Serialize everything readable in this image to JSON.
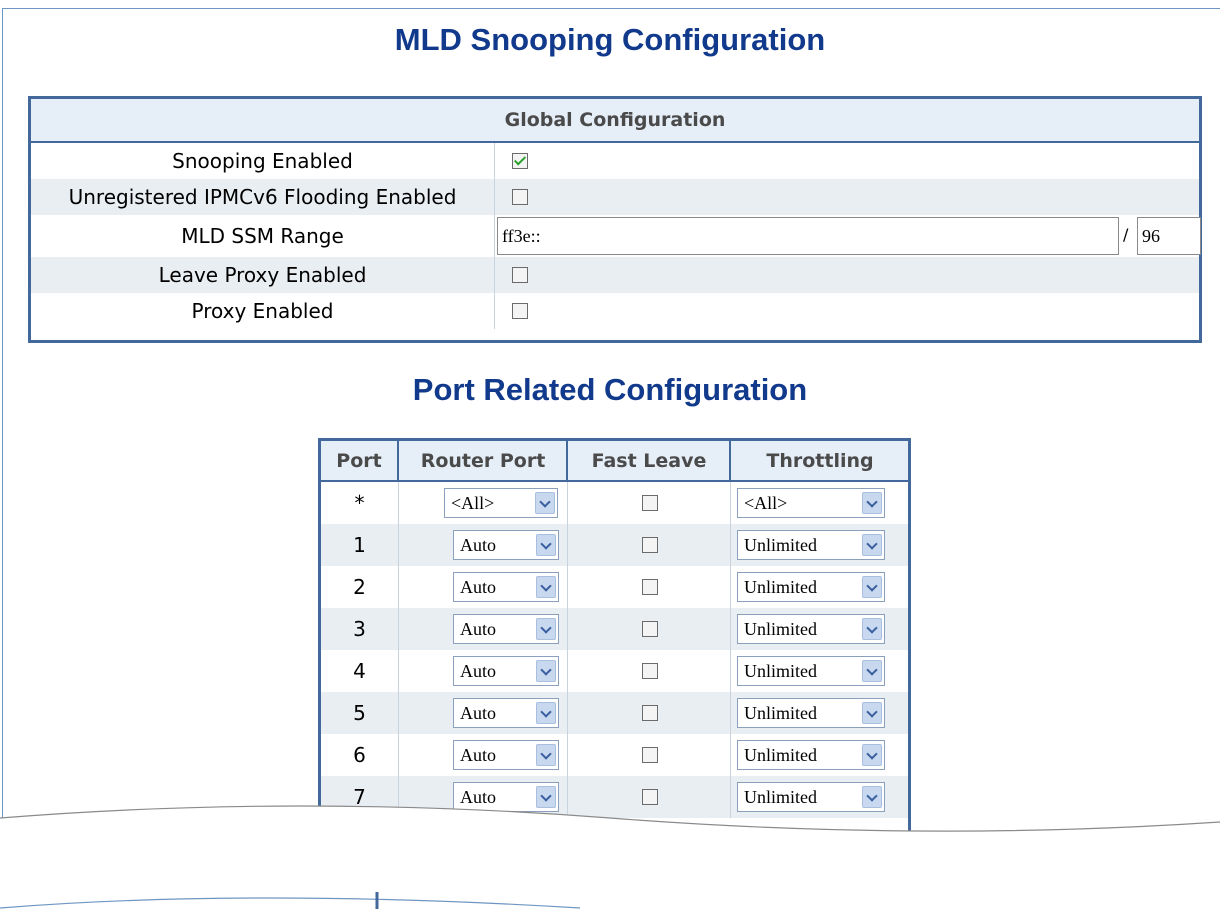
{
  "page_title": "MLD Snooping Configuration",
  "global": {
    "header": "Global Configuration",
    "rows": [
      {
        "label": "Snooping Enabled",
        "checked": true
      },
      {
        "label": "Unregistered IPMCv6 Flooding Enabled",
        "checked": false
      },
      {
        "label": "MLD SSM Range",
        "address": "ff3e::",
        "separator": "/",
        "prefix": "96"
      },
      {
        "label": "Leave Proxy Enabled",
        "checked": false
      },
      {
        "label": "Proxy Enabled",
        "checked": false
      }
    ]
  },
  "port_title": "Port Related Configuration",
  "port_table": {
    "headers": [
      "Port",
      "Router Port",
      "Fast Leave",
      "Throttling"
    ],
    "rows": [
      {
        "port": "*",
        "router": "<All>",
        "fast_leave": false,
        "throttling": "<All>"
      },
      {
        "port": "1",
        "router": "Auto",
        "fast_leave": false,
        "throttling": "Unlimited"
      },
      {
        "port": "2",
        "router": "Auto",
        "fast_leave": false,
        "throttling": "Unlimited"
      },
      {
        "port": "3",
        "router": "Auto",
        "fast_leave": false,
        "throttling": "Unlimited"
      },
      {
        "port": "4",
        "router": "Auto",
        "fast_leave": false,
        "throttling": "Unlimited"
      },
      {
        "port": "5",
        "router": "Auto",
        "fast_leave": false,
        "throttling": "Unlimited"
      },
      {
        "port": "6",
        "router": "Auto",
        "fast_leave": false,
        "throttling": "Unlimited"
      },
      {
        "port": "7",
        "router": "Auto",
        "fast_leave": false,
        "throttling": "Unlimited"
      }
    ]
  },
  "colors": {
    "title": "#123a8c",
    "border": "#43689c",
    "header_bg": "#e6eef8",
    "alt_row": "#e9eef3"
  }
}
